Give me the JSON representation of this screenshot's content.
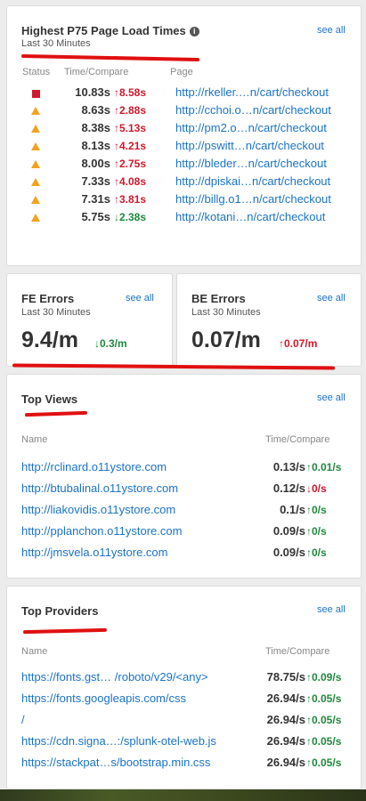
{
  "p75": {
    "title": "Highest P75 Page Load Times",
    "info_icon": "info-icon",
    "subtitle": "Last 30 Minutes",
    "see_all": "see all",
    "col_status": "Status",
    "col_time": "Time/Compare",
    "col_page": "Page",
    "rows": [
      {
        "status": "critical",
        "time": "10.83s",
        "cmp": "↑8.58s",
        "page": "http://rkeller.…n/cart/checkout"
      },
      {
        "status": "warning",
        "time": "8.63s",
        "cmp": "↑2.88s",
        "page": "http://cchoi.o…n/cart/checkout"
      },
      {
        "status": "warning",
        "time": "8.38s",
        "cmp": "↑5.13s",
        "page": "http://pm2.o…n/cart/checkout"
      },
      {
        "status": "warning",
        "time": "8.13s",
        "cmp": "↑4.21s",
        "page": "http://pswitt…n/cart/checkout"
      },
      {
        "status": "warning",
        "time": "8.00s",
        "cmp": "↑2.75s",
        "page": "http://bleder…n/cart/checkout"
      },
      {
        "status": "warning",
        "time": "7.33s",
        "cmp": "↑4.08s",
        "page": "http://dpiskai…n/cart/checkout"
      },
      {
        "status": "warning",
        "time": "7.31s",
        "cmp": "↑3.81s",
        "page": "http://billg.o1…n/cart/checkout"
      },
      {
        "status": "warning",
        "time": "5.75s",
        "cmp": "↓2.38s",
        "page": "http://kotani…n/cart/checkout"
      }
    ]
  },
  "fe_errors": {
    "title": "FE Errors",
    "subtitle": "Last 30 Minutes",
    "see_all": "see all",
    "value": "9.4/m",
    "cmp": "↓0.3/m"
  },
  "be_errors": {
    "title": "BE Errors",
    "subtitle": "Last 30 Minutes",
    "see_all": "see all",
    "value": "0.07/m",
    "cmp": "↑0.07/m"
  },
  "top_views": {
    "title": "Top Views",
    "see_all": "see all",
    "col_name": "Name",
    "col_time": "Time/Compare",
    "rows": [
      {
        "name": "http://rclinard.o11ystore.com",
        "val": "0.13/s",
        "cmp": "↑0.01/s"
      },
      {
        "name": "http://btubalinal.o11ystore.com",
        "val": "0.12/s",
        "cmp": "↓0/s"
      },
      {
        "name": "http://liakovidis.o11ystore.com",
        "val": "0.1/s",
        "cmp": "↑0/s"
      },
      {
        "name": "http://pplanchon.o11ystore.com",
        "val": "0.09/s",
        "cmp": "↑0/s"
      },
      {
        "name": "http://jmsvela.o11ystore.com",
        "val": "0.09/s",
        "cmp": "↑0/s"
      }
    ]
  },
  "top_providers": {
    "title": "Top Providers",
    "see_all": "see all",
    "col_name": "Name",
    "col_time": "Time/Compare",
    "rows": [
      {
        "name": "https://fonts.gst… /roboto/v29/<any>",
        "val": "78.75/s",
        "cmp": "↑0.09/s"
      },
      {
        "name": "https://fonts.googleapis.com/css",
        "val": "26.94/s",
        "cmp": "↑0.05/s"
      },
      {
        "name": "/",
        "val": "26.94/s",
        "cmp": "↑0.05/s"
      },
      {
        "name": "https://cdn.signa…:/splunk-otel-web.js",
        "val": "26.94/s",
        "cmp": "↑0.05/s"
      },
      {
        "name": "https://stackpat…s/bootstrap.min.css",
        "val": "26.94/s",
        "cmp": "↑0.05/s"
      }
    ]
  },
  "colors": {
    "link": "#1a73c9",
    "up_bad": "#d0192b",
    "good": "#1e8a3c",
    "warning": "#f3a21c",
    "annotation": "#e01010"
  }
}
